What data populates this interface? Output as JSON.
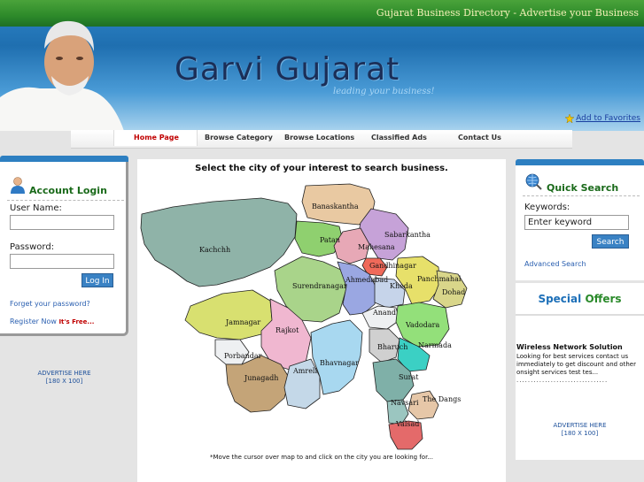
{
  "header": {
    "top_text": "Gujarat Business Directory - Advertise your Business",
    "title": "Garvi Gujarat",
    "tagline": "leading your business!",
    "favorites": "Add to Favorites"
  },
  "nav": {
    "items": [
      {
        "label": "Home Page",
        "active": true
      },
      {
        "label": "Browse Category"
      },
      {
        "label": "Browse Locations"
      },
      {
        "label": "Classified Ads"
      },
      {
        "label": "Contact Us"
      }
    ]
  },
  "login": {
    "title": "Account Login",
    "username_label": "User Name:",
    "password_label": "Password:",
    "button": "Log In",
    "forgot": "Forget your password?",
    "register": "Register Now",
    "register_free": "It's Free..."
  },
  "left_ad": {
    "line1": "ADVERTISE HERE",
    "line2": "[180 X 100]"
  },
  "center": {
    "heading": "Select the city of your interest to search business.",
    "note": "*Move the cursor over map to and click on the city you are looking for..."
  },
  "map": {
    "districts": [
      "Banaskantha",
      "Patan",
      "Sabarkantha",
      "Mahesana",
      "Kachchh",
      "Gandhinagar",
      "Ahmedabad",
      "Surendranagar",
      "Kheda",
      "Panchmahal",
      "Dohad",
      "Anand",
      "Vadodara",
      "Jamnagar",
      "Rajkot",
      "Bharuch",
      "Narmada",
      "Porbandar",
      "Junagadh",
      "Amreli",
      "Bhavnagar",
      "Surat",
      "Navsari",
      "The Dangs",
      "Valsad"
    ],
    "colors": {
      "sea": "#ffffff",
      "outline": "#222222"
    }
  },
  "quick_search": {
    "title": "Quick Search",
    "keywords_label": "Keywords:",
    "keywords_value": "Enter keyword",
    "button": "Search",
    "advanced": "Advanced Search"
  },
  "offers": {
    "title_word1": "Special",
    "title_word2": "Offers",
    "item_title": "Wireless Network Solution",
    "item_desc": "Looking for best services contact us immediately to get discount and other onsight services test tes...",
    "dots": "................................"
  },
  "right_ad": {
    "line1": "ADVERTISE HERE",
    "line2": "[180 X 100]"
  },
  "colors": {
    "accent_blue": "#2d7fc1",
    "accent_green": "#2d8a2a",
    "active_nav": "#c00000"
  }
}
